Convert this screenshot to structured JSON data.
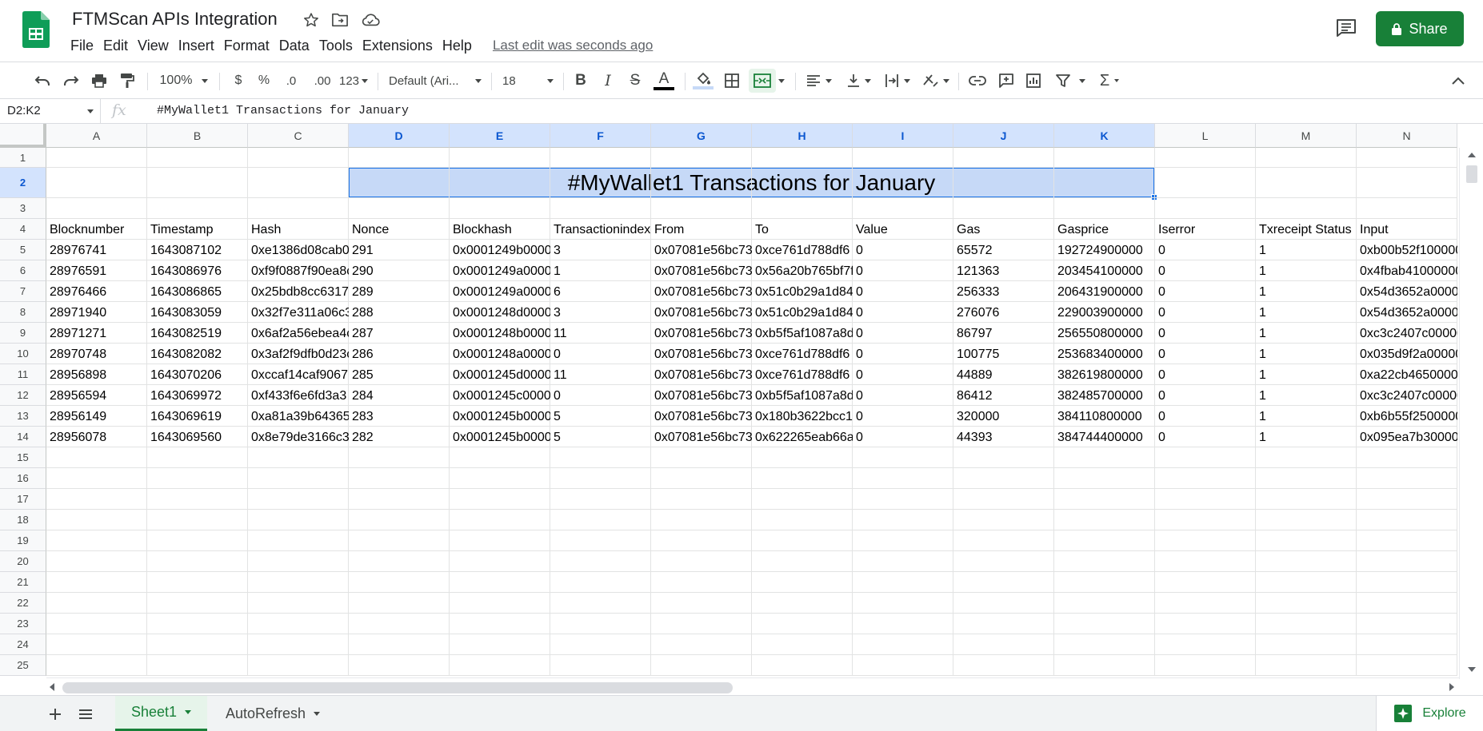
{
  "app": {
    "doc_title": "FTMScan APIs Integration",
    "last_edit": "Last edit was seconds ago",
    "share_label": "Share",
    "accent_color": "#188038"
  },
  "menu": [
    "File",
    "Edit",
    "View",
    "Insert",
    "Format",
    "Data",
    "Tools",
    "Extensions",
    "Help"
  ],
  "toolbar": {
    "zoom": "100%",
    "currency": "$",
    "percent": "%",
    "decrease_decimal": ".0",
    "increase_decimal": ".00",
    "more_formats": "123",
    "font_family": "Default (Ari...",
    "font_size": "18"
  },
  "formula_bar": {
    "name_box": "D2:K2",
    "fx": "fx",
    "content": "#MyWallet1 Transactions for January"
  },
  "grid": {
    "columns": [
      "A",
      "B",
      "C",
      "D",
      "E",
      "F",
      "G",
      "H",
      "I",
      "J",
      "K",
      "L",
      "M",
      "N"
    ],
    "row_numbers": [
      "1",
      "2",
      "3",
      "4",
      "5",
      "6",
      "7",
      "8",
      "9",
      "10",
      "11",
      "12",
      "13",
      "14",
      "15",
      "16",
      "17",
      "18",
      "19",
      "20",
      "21",
      "22",
      "23",
      "24",
      "25"
    ],
    "title": "#MyWallet1 Transactions for January",
    "headers": [
      "Blocknumber",
      "Timestamp",
      "Hash",
      "Nonce",
      "Blockhash",
      "Transactionindex",
      "From",
      "To",
      "Value",
      "Gas",
      "Gasprice",
      "Iserror",
      "Txreceipt Status",
      "Input"
    ],
    "rows": [
      [
        "28976741",
        "1643087102",
        "0xe1386d08cab0",
        "291",
        "0x0001249b0000",
        "3",
        "0x07081e56bc73",
        "0xce761d788df6",
        "0",
        "65572",
        "192724900000",
        "0",
        "1",
        "0xb00b52f1000000"
      ],
      [
        "28976591",
        "1643086976",
        "0xf9f0887f90ea8c",
        "290",
        "0x0001249a0000",
        "1",
        "0x07081e56bc73",
        "0x56a20b765bf7f",
        "0",
        "121363",
        "203454100000",
        "0",
        "1",
        "0x4fbab410000000"
      ],
      [
        "28976466",
        "1643086865",
        "0x25bdb8cc6317",
        "289",
        "0x0001249a0000",
        "6",
        "0x07081e56bc73",
        "0x51c0b29a1d84",
        "0",
        "256333",
        "206431900000",
        "0",
        "1",
        "0x54d3652a00000"
      ],
      [
        "28971940",
        "1643083059",
        "0x32f7e311a06c3",
        "288",
        "0x0001248d0000",
        "3",
        "0x07081e56bc73",
        "0x51c0b29a1d84",
        "0",
        "276076",
        "229003900000",
        "0",
        "1",
        "0x54d3652a00000"
      ],
      [
        "28971271",
        "1643082519",
        "0x6af2a56ebea4c",
        "287",
        "0x0001248b0000",
        "11",
        "0x07081e56bc73",
        "0xb5f5af1087a8d",
        "0",
        "86797",
        "256550800000",
        "0",
        "1",
        "0xc3c2407c00000"
      ],
      [
        "28970748",
        "1643082082",
        "0x3af2f9dfb0d23c",
        "286",
        "0x0001248a0000",
        "0",
        "0x07081e56bc73",
        "0xce761d788df6",
        "0",
        "100775",
        "253683400000",
        "0",
        "1",
        "0x035d9f2a00000"
      ],
      [
        "28956898",
        "1643070206",
        "0xccaf14caf9067",
        "285",
        "0x0001245d0000",
        "11",
        "0x07081e56bc73",
        "0xce761d788df6",
        "0",
        "44889",
        "382619800000",
        "0",
        "1",
        "0xa22cb46500000"
      ],
      [
        "28956594",
        "1643069972",
        "0xf433f6e6fd3a3",
        "284",
        "0x0001245c0000",
        "0",
        "0x07081e56bc73",
        "0xb5f5af1087a8d",
        "0",
        "86412",
        "382485700000",
        "0",
        "1",
        "0xc3c2407c00000"
      ],
      [
        "28956149",
        "1643069619",
        "0xa81a39b64365",
        "283",
        "0x0001245b0000",
        "5",
        "0x07081e56bc73",
        "0x180b3622bcc1",
        "0",
        "320000",
        "384110800000",
        "0",
        "1",
        "0xb6b55f25000000"
      ],
      [
        "28956078",
        "1643069560",
        "0x8e79de3166c3",
        "282",
        "0x0001245b0000",
        "5",
        "0x07081e56bc73",
        "0x622265eab66a",
        "0",
        "44393",
        "384744400000",
        "0",
        "1",
        "0x095ea7b300000"
      ]
    ]
  },
  "sheets": {
    "tabs": [
      "Sheet1",
      "AutoRefresh"
    ],
    "active": "Sheet1",
    "explore_label": "Explore"
  }
}
